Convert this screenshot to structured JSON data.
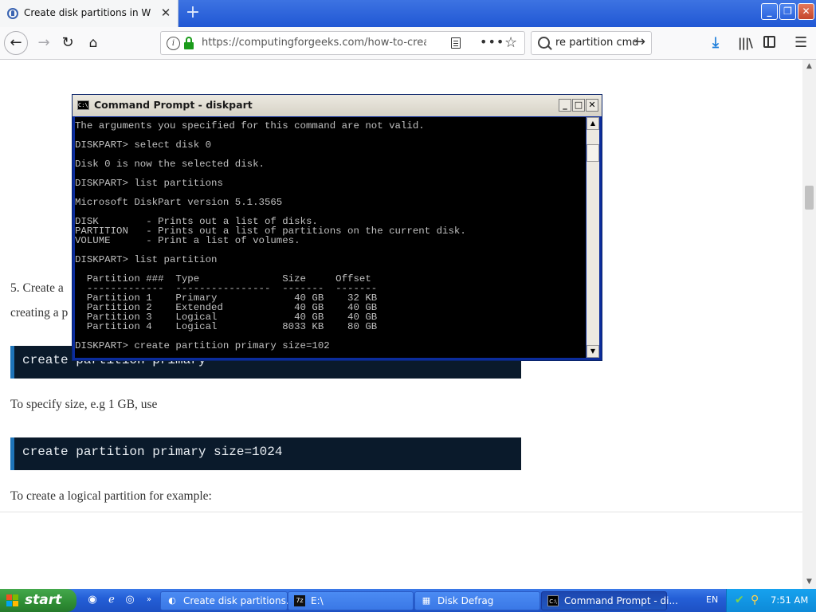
{
  "browser": {
    "tab_title": "Create disk partitions in Windows",
    "tab_close": "✕",
    "new_tab": "+",
    "window_buttons": [
      "_",
      "❐",
      "✕"
    ],
    "url": "https://computingforgeeks.com/how-to-create-d",
    "search_query": "re partition cmd",
    "nav_icons": [
      "back-icon",
      "forward-icon",
      "reload-icon",
      "home-icon"
    ]
  },
  "page": {
    "para1_line1": "5. Create a",
    "para1_line2": "creating a p",
    "code1": "create partition primary",
    "para2": "To specify size, e.g 1 GB, use",
    "code2": "create partition primary size=1024",
    "para3": "To create a logical partition for example:"
  },
  "cmd": {
    "title": "Command Prompt - diskpart",
    "icon_text": "C:\\",
    "console_lines": [
      "",
      "The arguments you specified for this command are not valid.",
      "",
      "DISKPART> select disk 0",
      "",
      "Disk 0 is now the selected disk.",
      "",
      "DISKPART> list partitions",
      "",
      "Microsoft DiskPart version 5.1.3565",
      "",
      "DISK        - Prints out a list of disks.",
      "PARTITION   - Prints out a list of partitions on the current disk.",
      "VOLUME      - Print a list of volumes.",
      "",
      "DISKPART> list partition",
      "",
      "  Partition ###  Type              Size     Offset",
      "  -------------  ----------------  -------  -------",
      "  Partition 1    Primary             40 GB    32 KB",
      "  Partition 2    Extended            40 GB    40 GB",
      "  Partition 3    Logical             40 GB    40 GB",
      "  Partition 4    Logical           8033 KB    80 GB",
      "",
      "DISKPART> create partition primary size=102"
    ]
  },
  "taskbar": {
    "start": "start",
    "buttons": [
      {
        "label": "Create disk partitions...",
        "icon": "firefox-icon",
        "active": false
      },
      {
        "label": "E:\\",
        "icon": "7zip-icon",
        "active": false
      },
      {
        "label": "Disk Defrag",
        "icon": "defrag-icon",
        "active": false
      },
      {
        "label": "Command Prompt - di...",
        "icon": "cmd-icon",
        "active": true
      }
    ],
    "language": "EN",
    "clock": "7:51 AM"
  },
  "colors": {
    "cmd_title_bg": "#ece9e1",
    "code_bg": "#0a1a2b",
    "code_border": "#1e74b8",
    "taskbar": "#245fd7",
    "start": "#2f8e35"
  }
}
